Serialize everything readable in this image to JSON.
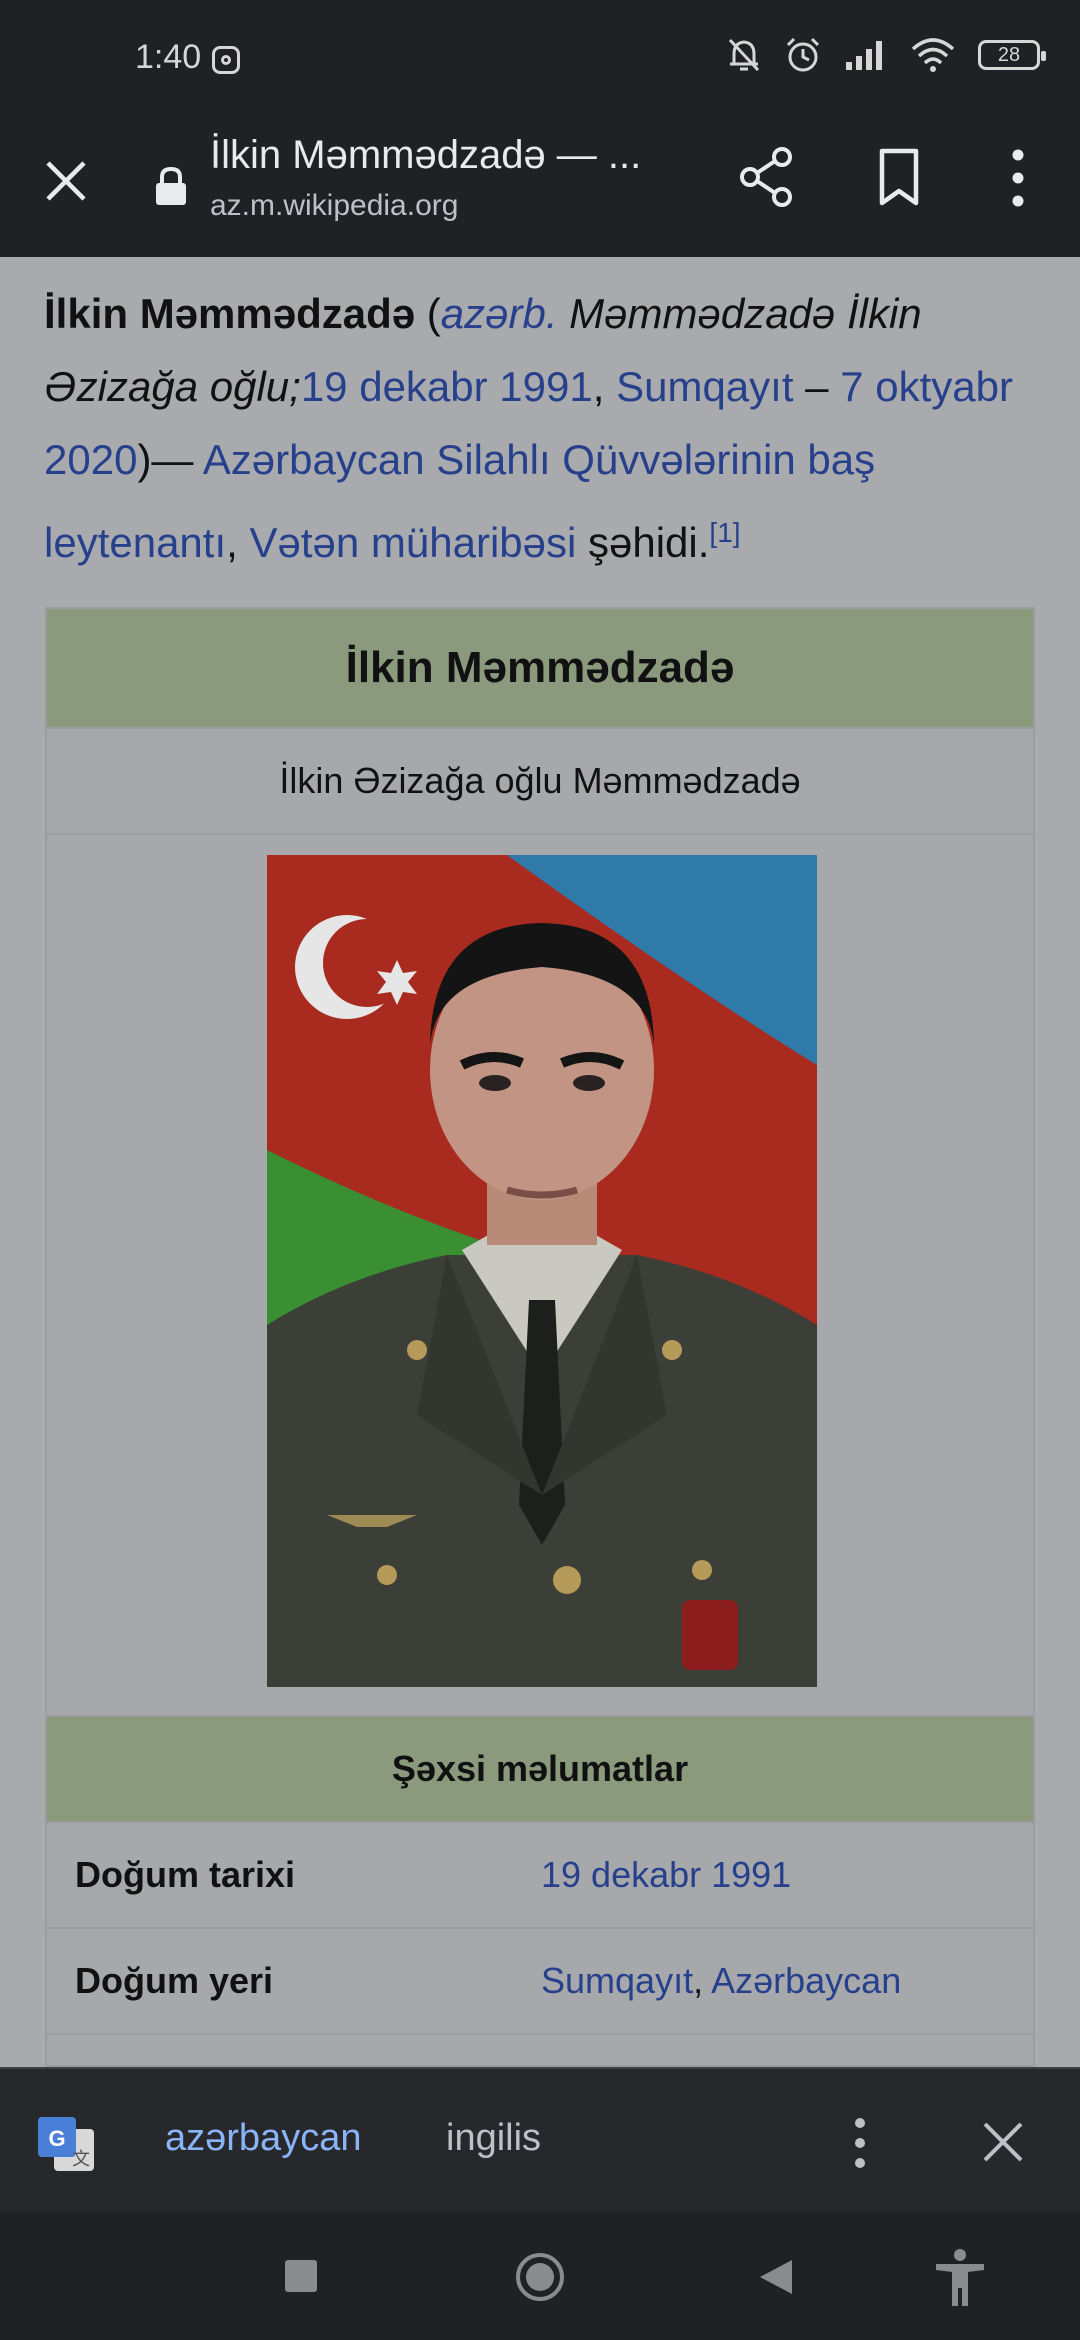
{
  "status_bar": {
    "time": "1:40",
    "battery": "28",
    "icons": [
      "instagram-icon",
      "bell-muted-icon",
      "alarm-icon",
      "signal-icon",
      "wifi-icon",
      "battery-icon"
    ]
  },
  "toolbar": {
    "title": "İlkin Məmmədzadə — ...",
    "url": "az.m.wikipedia.org",
    "icons": [
      "close-icon",
      "lock-icon",
      "share-icon",
      "bookmark-icon",
      "more-vert-icon"
    ]
  },
  "article": {
    "lead": {
      "name": "İlkin Məmmədzadə",
      "open_paren": " (",
      "lang_link": "azərb.",
      "native_name": " Məmmədzadə İlkin Əzizağa oğlu;",
      "birth_date_link": "19 dekabr 1991",
      "comma1": ", ",
      "birth_place_link": "Sumqayıt",
      "dash": " – ",
      "death_date_link": "7 oktyabr 2020",
      "close_dash": ")— ",
      "army_link": "Azərbaycan Silahlı Qüvvələrinin baş leytenantı",
      "comma2": ", ",
      "war_link": "Vətən müharibəsi",
      "tail": " şəhidi.",
      "ref": "[1]"
    },
    "infobox": {
      "title": "İlkin Məmmədzadə",
      "subtitle": "İlkin Əzizağa oğlu Məmmədzadə",
      "section": "Şəxsi məlumatlar",
      "rows": [
        {
          "key": "Doğum tarixi",
          "value": "19 dekabr 1991"
        },
        {
          "key": "Doğum yeri",
          "value_part1": "Sumqayıt",
          "sep": ", ",
          "value_part2": "Azərbaycan"
        }
      ]
    }
  },
  "translate_bar": {
    "source_lang": "azərbaycan",
    "target_lang": "ingilis",
    "icons": [
      "google-translate-icon",
      "more-vert-icon",
      "close-icon"
    ]
  },
  "nav_bar": {
    "icons": [
      "recents-icon",
      "home-icon",
      "back-icon",
      "accessibility-icon"
    ]
  },
  "colors": {
    "link": "#27408b",
    "infobox_header": "#8b9a7d",
    "page_bg_dimmed": "#a8aaad",
    "chrome_bg": "#202124",
    "translate_active": "#8ab4f8"
  }
}
